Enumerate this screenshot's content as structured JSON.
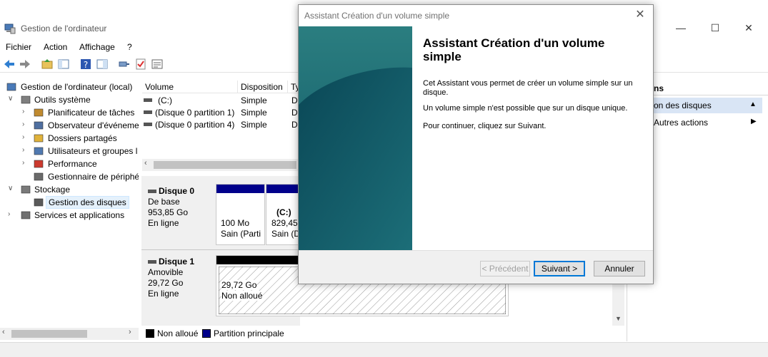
{
  "window": {
    "title": "Gestion de l'ordinateur",
    "minimize_icon": "minimize-icon",
    "maximize_icon": "maximize-icon",
    "close_icon": "close-icon"
  },
  "menu": [
    "Fichier",
    "Action",
    "Affichage",
    "?"
  ],
  "tree": {
    "items": [
      {
        "label": "Gestion de l'ordinateur (local)",
        "icon": "computer-management-icon",
        "twisty": ""
      },
      {
        "label": "Outils système",
        "icon": "tools-icon",
        "twisty": "∨"
      },
      {
        "label": "Planificateur de tâches",
        "icon": "clock-icon",
        "twisty": "›"
      },
      {
        "label": "Observateur d'événeme",
        "icon": "event-viewer-icon",
        "twisty": "›"
      },
      {
        "label": "Dossiers partagés",
        "icon": "shared-folder-icon",
        "twisty": "›"
      },
      {
        "label": "Utilisateurs et groupes l",
        "icon": "users-icon",
        "twisty": "›"
      },
      {
        "label": "Performance",
        "icon": "performance-icon",
        "twisty": "›"
      },
      {
        "label": "Gestionnaire de périphé",
        "icon": "device-manager-icon",
        "twisty": ""
      },
      {
        "label": "Stockage",
        "icon": "storage-icon",
        "twisty": "∨"
      },
      {
        "label": "Gestion des disques",
        "icon": "disk-icon",
        "twisty": ""
      },
      {
        "label": "Services et applications",
        "icon": "services-icon",
        "twisty": "›"
      }
    ],
    "selected_index": 9
  },
  "volumes": {
    "headers": [
      "Volume",
      "Disposition",
      "Ty"
    ],
    "rows": [
      {
        "volume": "(C:)",
        "layout": "Simple",
        "type": "D"
      },
      {
        "volume": "(Disque 0 partition 1)",
        "layout": "Simple",
        "type": "D"
      },
      {
        "volume": "(Disque 0 partition 4)",
        "layout": "Simple",
        "type": "D"
      }
    ]
  },
  "disks": [
    {
      "name": "Disque 0",
      "kind": "De base",
      "size": "953,85 Go",
      "status": "En ligne",
      "partitions": [
        {
          "line1": "100 Mo",
          "line2": "Sain (Parti"
        },
        {
          "line1": "(C:)",
          "line2": "829,45 G",
          "line3": "Sain (D"
        }
      ]
    },
    {
      "name": "Disque 1",
      "kind": "Amovible",
      "size": "29,72 Go",
      "status": "En ligne",
      "partitions": [
        {
          "line1": "29,72 Go",
          "line2": "Non alloué"
        }
      ]
    }
  ],
  "legend": [
    {
      "label": "Non alloué",
      "color": "#000000"
    },
    {
      "label": "Partition principale",
      "color": "#00008b"
    }
  ],
  "actions": {
    "header": "ns",
    "sub": "on des disques",
    "more": "Autres actions"
  },
  "wizard": {
    "title": "Assistant Création d'un volume simple",
    "heading": "Assistant Création d'un volume simple",
    "paragraphs": [
      "Cet Assistant vous permet de créer un volume simple sur un disque.",
      "Un volume simple n'est possible que sur un disque unique.",
      "Pour continuer, cliquez sur Suivant."
    ],
    "buttons": {
      "back": "< Précédent",
      "next": "Suivant >",
      "cancel": "Annuler"
    }
  },
  "colors": {
    "primary_partition": "#00008b",
    "unallocated": "#000000",
    "banner_dark": "#0b4f5c",
    "banner_light": "#2a8a8e",
    "selection": "#d9e5f5"
  }
}
